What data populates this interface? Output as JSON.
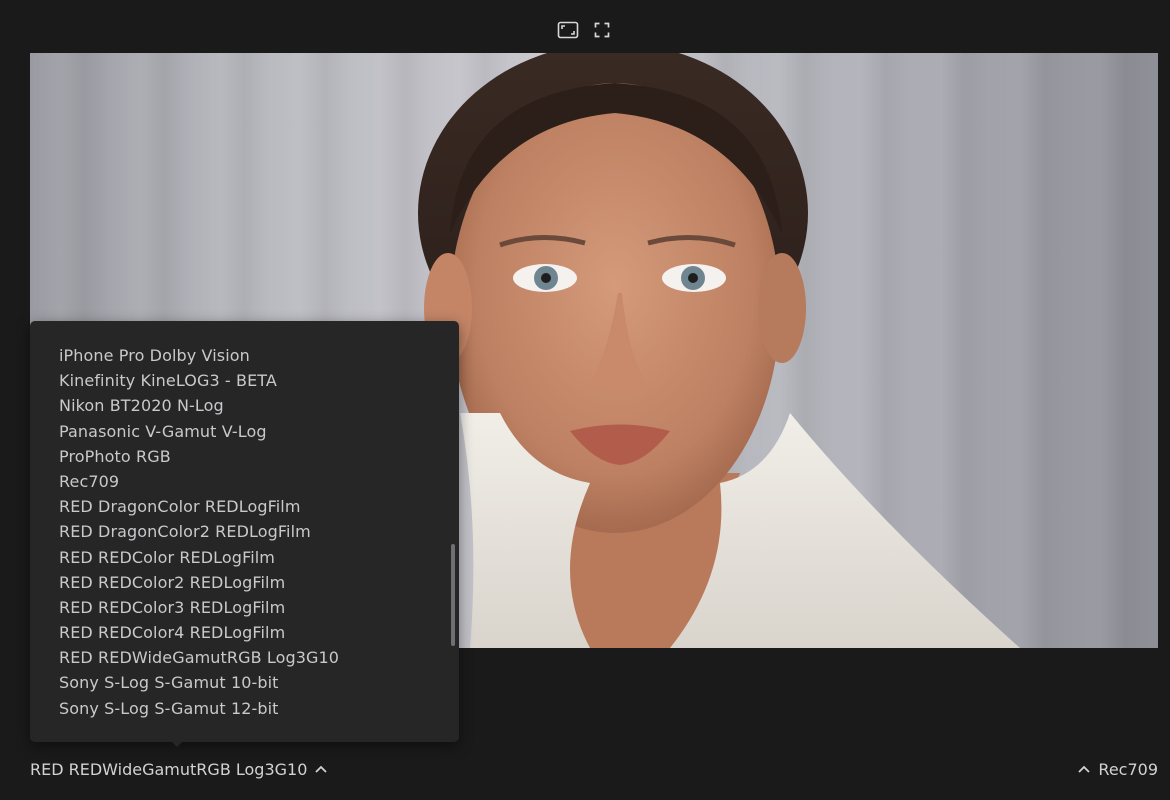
{
  "toolbar": {
    "icons": [
      "fit-frame-icon",
      "fullscreen-icon"
    ]
  },
  "preview": {
    "subject": "portrait-photo"
  },
  "colorspace_menu": {
    "items": [
      "iPhone Pro Dolby Vision",
      "Kinefinity KineLOG3 - BETA",
      "Nikon BT2020 N-Log",
      "Panasonic V-Gamut V-Log",
      "ProPhoto RGB",
      "Rec709",
      "RED DragonColor REDLogFilm",
      "RED DragonColor2 REDLogFilm",
      "RED REDColor REDLogFilm",
      "RED REDColor2 REDLogFilm",
      "RED REDColor3 REDLogFilm",
      "RED REDColor4 REDLogFilm",
      "RED REDWideGamutRGB Log3G10",
      "Sony S-Log S-Gamut 10-bit",
      "Sony S-Log S-Gamut 12-bit"
    ]
  },
  "bottom_bar": {
    "source_colorspace": "RED REDWideGamutRGB Log3G10",
    "target_colorspace": "Rec709",
    "source_icon": "chevron-up-icon",
    "target_icon": "chevron-up-icon"
  },
  "colors": {
    "background": "#1a1a1b",
    "menu_bg": "#262627",
    "menu_text": "#c9c9cb",
    "label_text": "#d2d2d4"
  }
}
